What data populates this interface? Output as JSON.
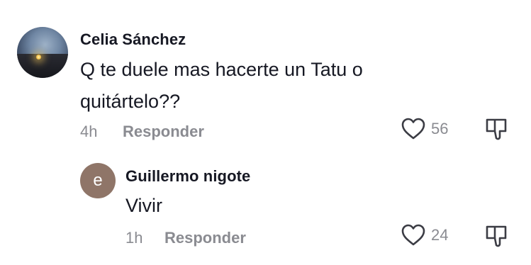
{
  "comments": [
    {
      "author": "Celia Sánchez",
      "text_line1": "Q te duele mas hacerte un Tatu o",
      "text_line2": "quitártelo??",
      "time": "4h",
      "reply_label": "Responder",
      "likes": "56"
    },
    {
      "author": "Guillermo nigote",
      "avatar_letter": "e",
      "avatar_color": "#8f7568",
      "text": "Vivir",
      "time": "1h",
      "reply_label": "Responder",
      "likes": "24"
    }
  ],
  "colors": {
    "primary_text": "#161823",
    "secondary_text": "#8a8b91",
    "icon": "#3b3c44"
  },
  "icons": [
    "heart-outline-icon",
    "thumbs-down-icon"
  ]
}
